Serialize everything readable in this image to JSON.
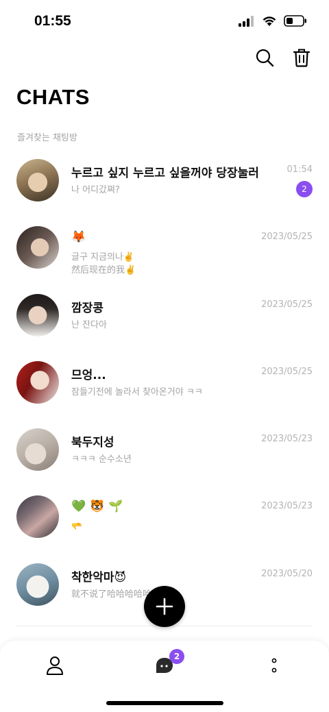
{
  "status_bar": {
    "time": "01:55"
  },
  "header": {
    "title": "CHATS",
    "section_label": "즐겨찾는 채팅방"
  },
  "chats": [
    {
      "name": "누르고 싶지 누르고 싶을꺼야 당장눌러",
      "preview": "나 어디갔쪄?",
      "preview2": "",
      "time": "01:54",
      "unread": "2"
    },
    {
      "name": "🦊",
      "preview": "글구 지금의나✌️",
      "preview2": "然后现在的我✌️",
      "time": "2023/05/25",
      "unread": ""
    },
    {
      "name": "깜장콩",
      "preview": "난 잔다아",
      "preview2": "",
      "time": "2023/05/25",
      "unread": ""
    },
    {
      "name": "므엉...",
      "preview": "잠들기전에 놀라서 찾아온거야 ㅋㅋ",
      "preview2": "",
      "time": "2023/05/25",
      "unread": ""
    },
    {
      "name": "북두지성",
      "preview": "ㅋㅋㅋ 순수소년",
      "preview2": "",
      "time": "2023/05/23",
      "unread": ""
    },
    {
      "name": "💚 🐯 🌱",
      "preview": "🫳",
      "preview2": "",
      "time": "2023/05/23",
      "unread": ""
    },
    {
      "name": "착한악마😈",
      "preview": "就不说了哈哈哈哈哈",
      "preview2": "",
      "time": "2023/05/20",
      "unread": ""
    }
  ],
  "tab_bar": {
    "chats_badge": "2"
  },
  "colors": {
    "accent": "#8a4ef0",
    "muted_text": "#a3a3a3"
  }
}
